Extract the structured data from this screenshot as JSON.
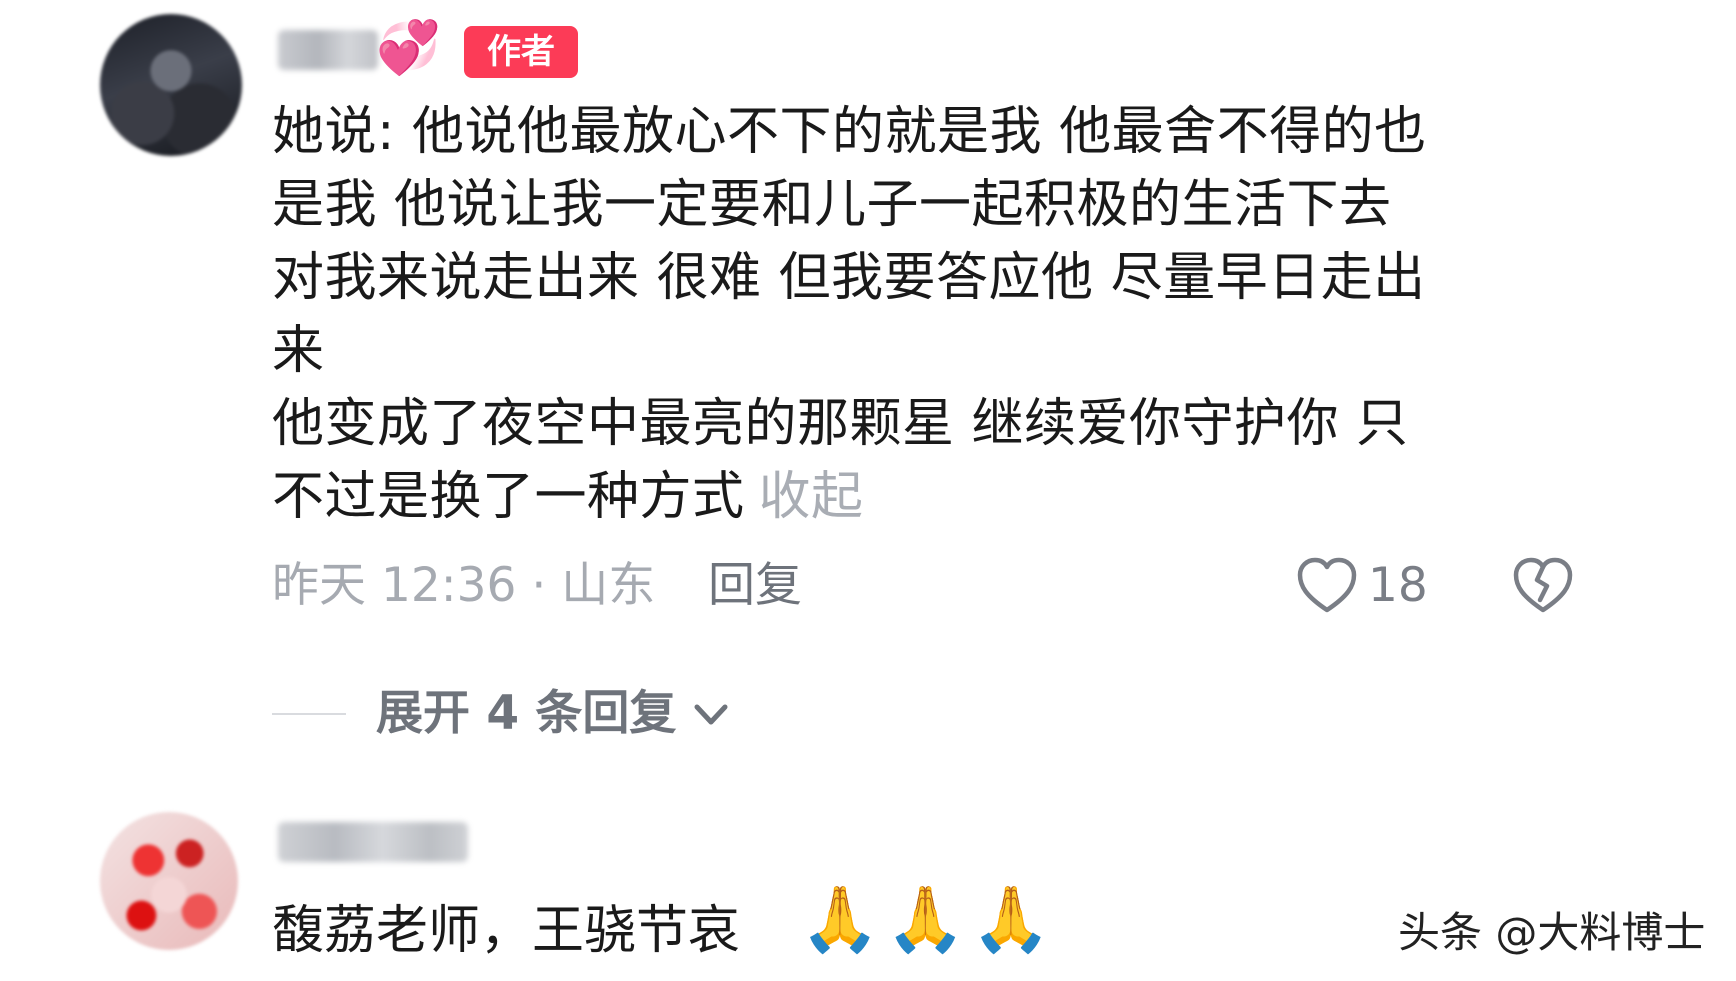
{
  "comment1": {
    "author_badge": "作者",
    "avatar_icon": "avatar-icon",
    "name_emoji": "💞",
    "text_lines": [
      "她说: 他说他最放心不下的就是我 他最舍不得的也",
      "是我 他说让我一定要和儿子一起积极的生活下去",
      "对我来说走出来 很难 但我要答应他 尽量早日走出",
      "来",
      "他变成了夜空中最亮的那颗星 继续爱你守护你 只",
      "不过是换了一种方式"
    ],
    "collapse_label": "收起",
    "meta": "昨天 12:36 · 山东",
    "reply_label": "回复",
    "like_count": "18",
    "like_icon": "heart-outline-icon",
    "dislike_icon": "broken-heart-icon",
    "expand_replies_label": "展开 4 条回复"
  },
  "comment2": {
    "text": "馥荔老师，王骁节哀",
    "emoji": "🙏🙏🙏"
  },
  "watermark": "头条 @大料博士",
  "colors": {
    "author_badge": "#fc3b57",
    "secondary_text": "#a6aab1",
    "primary_text": "#1a1a1a"
  }
}
